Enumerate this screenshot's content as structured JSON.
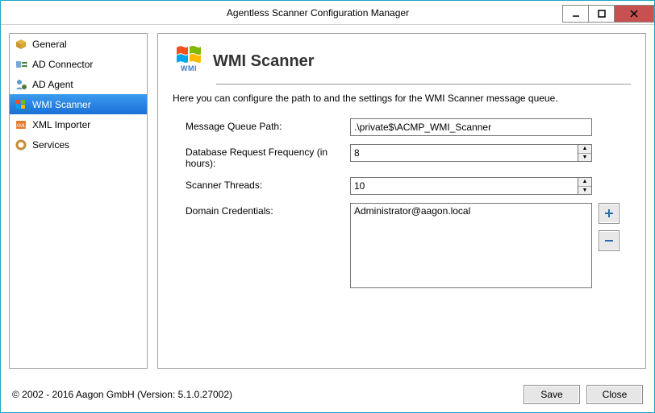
{
  "window": {
    "title": "Agentless Scanner Configuration Manager"
  },
  "sidebar": {
    "items": [
      {
        "label": "General"
      },
      {
        "label": "AD Connector"
      },
      {
        "label": "AD Agent"
      },
      {
        "label": "WMI Scanner"
      },
      {
        "label": "XML Importer"
      },
      {
        "label": "Services"
      }
    ]
  },
  "page": {
    "heading": "WMI Scanner",
    "logo_sub": "WMI",
    "description": "Here you can configure the path to and the settings for the WMI Scanner message queue."
  },
  "form": {
    "queue_label": "Message Queue Path:",
    "queue_value": ".\\private$\\ACMP_WMI_Scanner",
    "freq_label": "Database Request Frequency (in hours):",
    "freq_value": "8",
    "threads_label": "Scanner Threads:",
    "threads_value": "10",
    "creds_label": "Domain Credentials:",
    "cred_entry": "Administrator@aagon.local"
  },
  "footer": {
    "copyright": "© 2002 - 2016 Aagon GmbH (Version: 5.1.0.27002)",
    "save": "Save",
    "close": "Close"
  }
}
